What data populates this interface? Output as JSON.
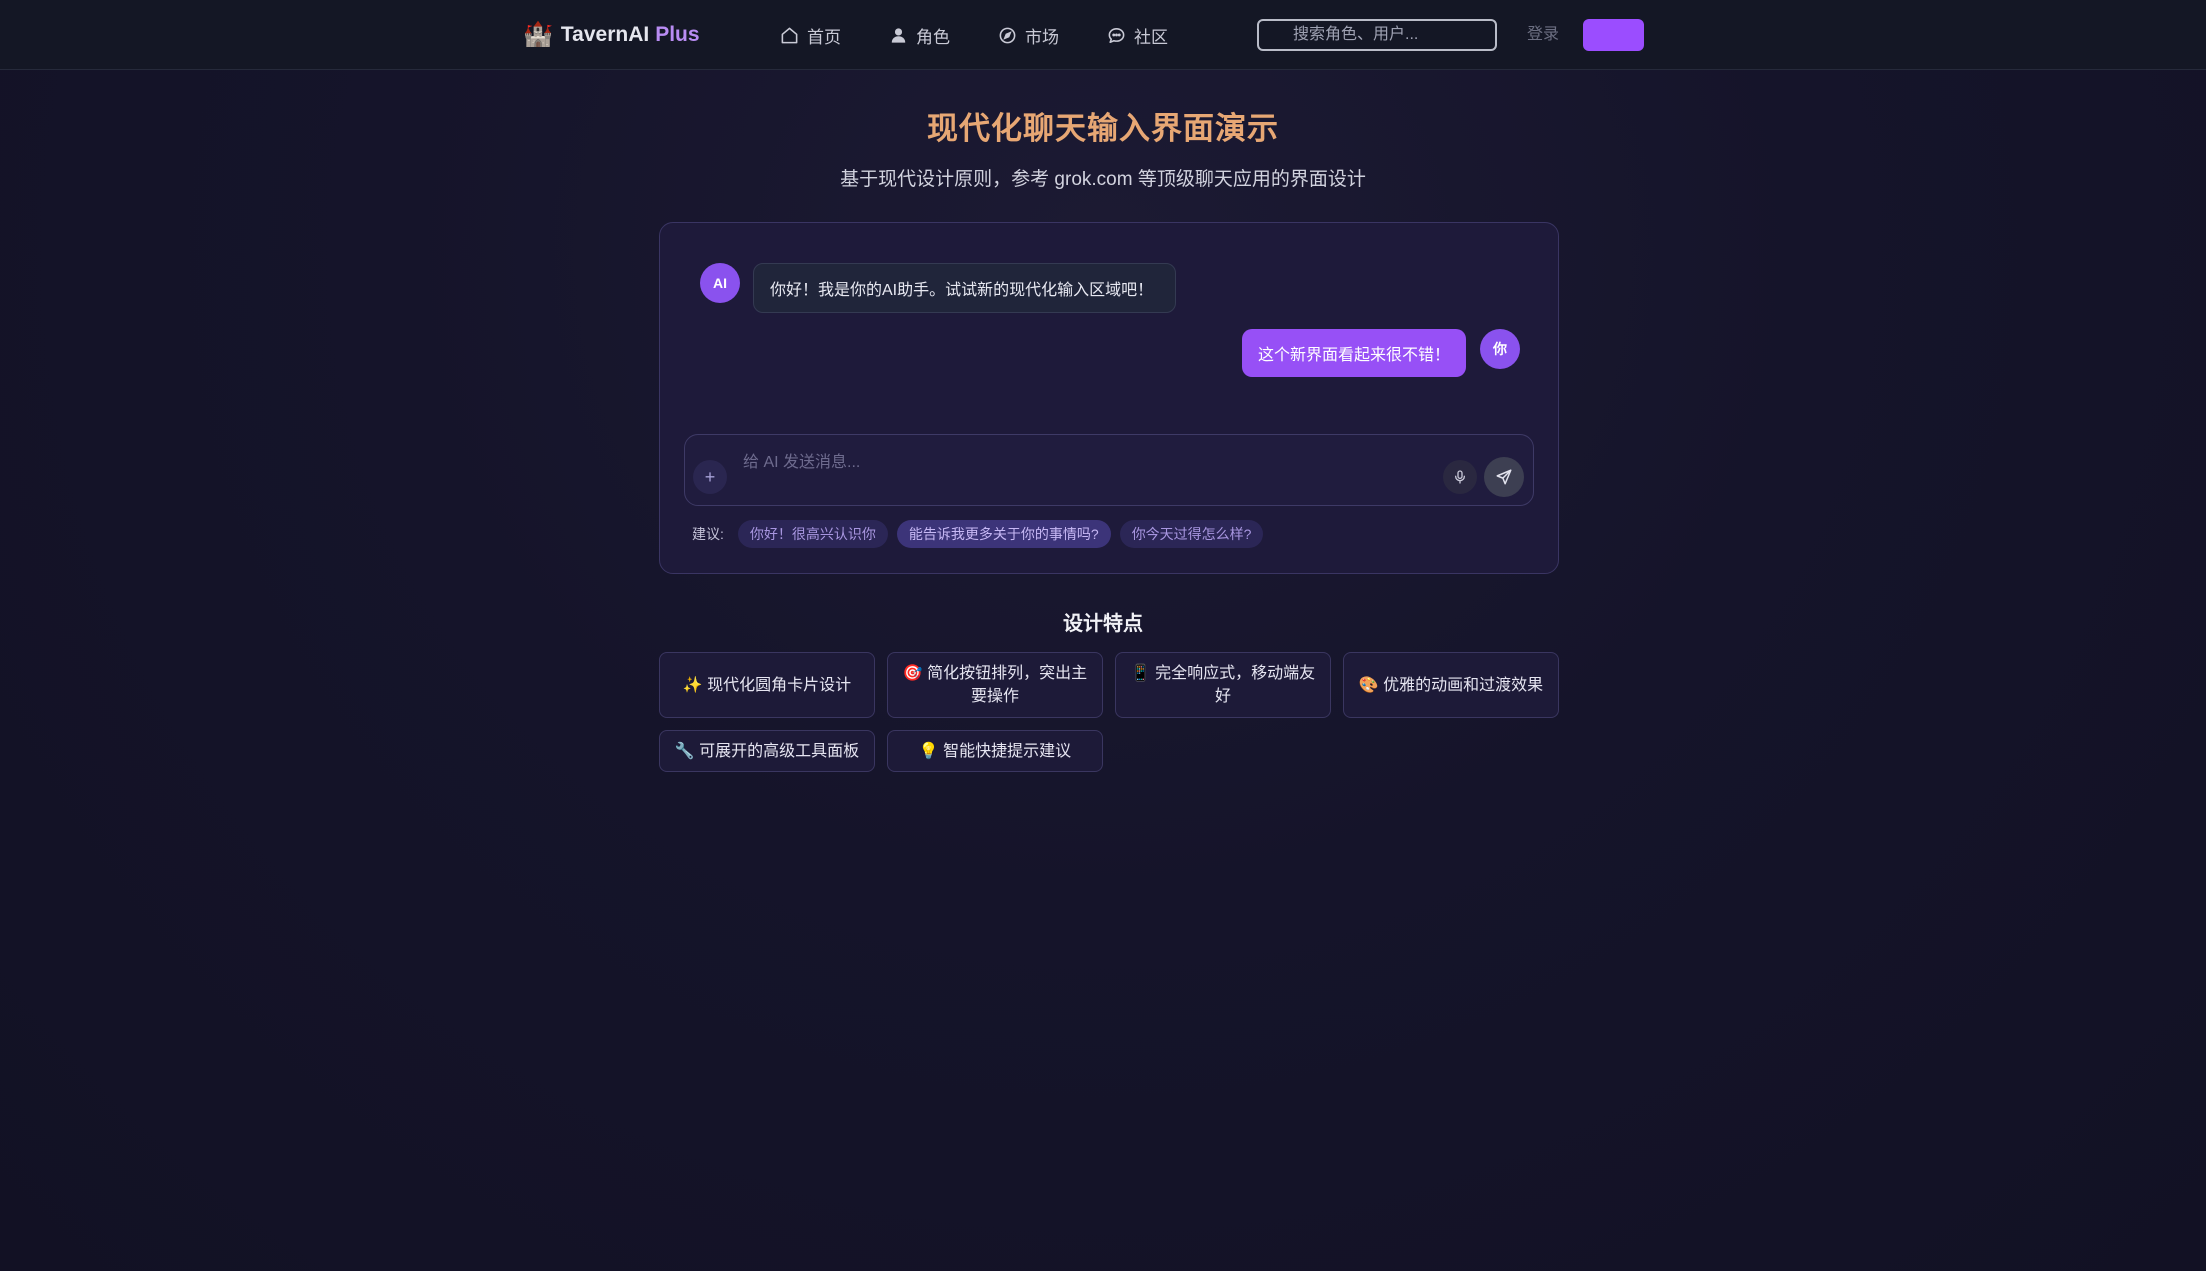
{
  "header": {
    "logo_icon": "🏰",
    "logo_text": "TavernAI",
    "logo_plus": "Plus",
    "nav": [
      {
        "label": "首页",
        "icon": "home-icon"
      },
      {
        "label": "角色",
        "icon": "user-icon"
      },
      {
        "label": "市场",
        "icon": "compass-icon"
      },
      {
        "label": "社区",
        "icon": "chat-bubble-icon"
      }
    ],
    "search_placeholder": "搜索角色、用户...",
    "login_label": "登录",
    "signup_label": ""
  },
  "main": {
    "title": "现代化聊天输入界面演示",
    "subtitle": "基于现代设计原则，参考 grok.com 等顶级聊天应用的界面设计"
  },
  "chat": {
    "ai_avatar": "AI",
    "ai_message": "你好！我是你的AI助手。试试新的现代化输入区域吧！",
    "user_avatar": "你",
    "user_message": "这个新界面看起来很不错！",
    "input_placeholder": "给 AI 发送消息...",
    "plus_label": "+",
    "suggestions_label": "建议:",
    "suggestions": [
      "你好！很高兴认识你",
      "能告诉我更多关于你的事情吗?",
      "你今天过得怎么样?"
    ]
  },
  "features": {
    "title": "设计特点",
    "items": [
      "✨ 现代化圆角卡片设计",
      "🎯 简化按钮排列，突出主要操作",
      "📱 完全响应式，移动端友好",
      "🎨 优雅的动画和过渡效果",
      "🔧 可展开的高级工具面板",
      "💡 智能快捷提示建议"
    ]
  },
  "colors": {
    "accent": "#9b4dff",
    "title": "#e7a774",
    "background": "#15142a"
  }
}
